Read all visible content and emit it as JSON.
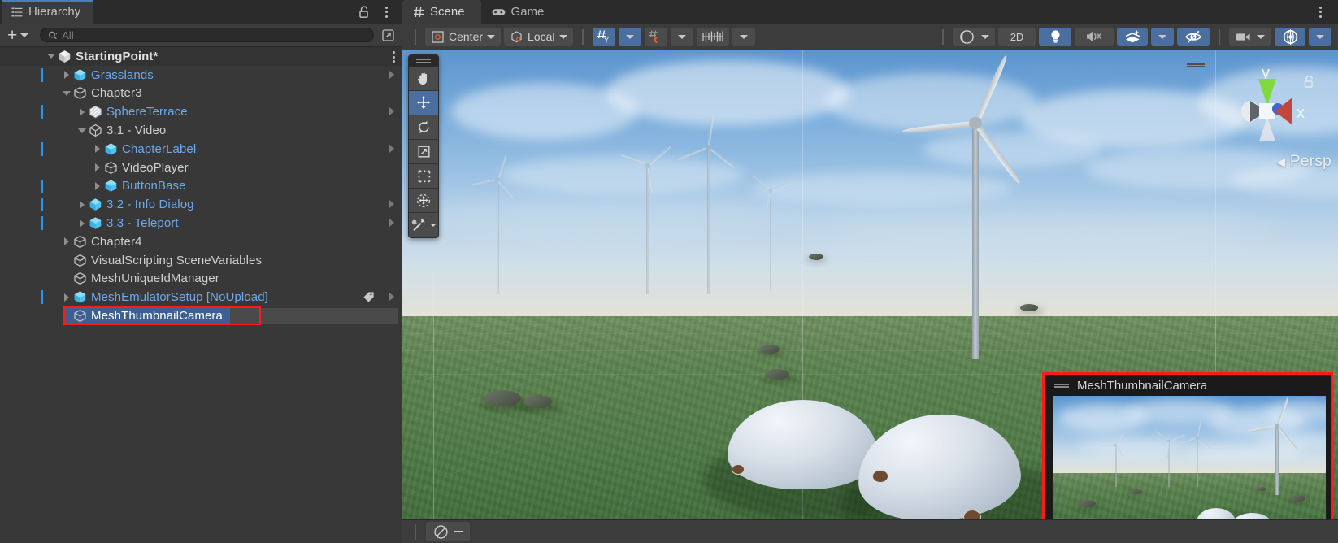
{
  "hierarchy": {
    "tab_label": "Hierarchy",
    "tab_icon": "hierarchy-icon",
    "lock_icon": "lock-open-icon",
    "menu_icon": "kebab-menu-icon",
    "create_label": "+",
    "search": {
      "placeholder": "All",
      "value": "",
      "icon": "search-icon"
    },
    "scene_visibility_icon": "scene-picking-icon",
    "items": [
      {
        "label": "StartingPoint*",
        "depth": 0,
        "icon": "unity-scene-icon",
        "style": "bold",
        "foldout": "down",
        "prefab_bar": false,
        "row_menu": true,
        "chevron": false
      },
      {
        "label": "Grasslands",
        "depth": 1,
        "icon": "prefab-icon",
        "style": "prefab",
        "foldout": "right",
        "prefab_bar": true,
        "chevron": true
      },
      {
        "label": "Chapter3",
        "depth": 1,
        "icon": "gameobject-icon",
        "style": "plain",
        "foldout": "down",
        "prefab_bar": false,
        "chevron": false
      },
      {
        "label": "SphereTerrace",
        "depth": 2,
        "icon": "prefab-variant-icon",
        "style": "prefab",
        "foldout": "right",
        "prefab_bar": true,
        "chevron": true
      },
      {
        "label": "3.1 - Video",
        "depth": 2,
        "icon": "gameobject-icon",
        "style": "plain",
        "foldout": "down",
        "prefab_bar": false,
        "chevron": false
      },
      {
        "label": "ChapterLabel",
        "depth": 3,
        "icon": "prefab-icon",
        "style": "prefab",
        "foldout": "right",
        "prefab_bar": true,
        "chevron": true
      },
      {
        "label": "VideoPlayer",
        "depth": 3,
        "icon": "gameobject-icon",
        "style": "plain",
        "foldout": "right",
        "prefab_bar": false,
        "chevron": false
      },
      {
        "label": "ButtonBase",
        "depth": 3,
        "icon": "prefab-icon",
        "style": "prefab",
        "foldout": "right",
        "prefab_bar": true,
        "chevron": false
      },
      {
        "label": "3.2 - Info Dialog",
        "depth": 2,
        "icon": "prefab-icon",
        "style": "prefab",
        "foldout": "right",
        "prefab_bar": true,
        "chevron": true
      },
      {
        "label": "3.3 - Teleport",
        "depth": 2,
        "icon": "prefab-icon",
        "style": "prefab",
        "foldout": "right",
        "prefab_bar": true,
        "chevron": true
      },
      {
        "label": "Chapter4",
        "depth": 1,
        "icon": "gameobject-icon",
        "style": "plain",
        "foldout": "right",
        "prefab_bar": false,
        "chevron": false
      },
      {
        "label": "VisualScripting SceneVariables",
        "depth": 1,
        "icon": "gameobject-icon",
        "style": "plain",
        "foldout": "none",
        "prefab_bar": false,
        "chevron": false
      },
      {
        "label": "MeshUniqueIdManager",
        "depth": 1,
        "icon": "gameobject-icon",
        "style": "plain",
        "foldout": "none",
        "prefab_bar": false,
        "chevron": false
      },
      {
        "label": "MeshEmulatorSetup [NoUpload]",
        "depth": 1,
        "icon": "prefab-icon",
        "style": "prefab",
        "foldout": "right",
        "prefab_bar": true,
        "chevron": true,
        "tag": true
      },
      {
        "label": "MeshThumbnailCamera",
        "depth": 1,
        "icon": "gameobject-icon",
        "style": "selected",
        "foldout": "none",
        "prefab_bar": false,
        "chevron": false,
        "selected": true,
        "highlight": true
      }
    ]
  },
  "scene": {
    "tabs": [
      {
        "label": "Scene",
        "icon": "grid-icon",
        "active": true
      },
      {
        "label": "Game",
        "icon": "gamepad-icon",
        "active": false
      }
    ],
    "menu_icon": "kebab-menu-icon",
    "toolbar": {
      "pivot_mode": {
        "label": "Center",
        "icon": "pivot-center-icon",
        "dropdown": true
      },
      "handle_space": {
        "label": "Local",
        "icon": "handle-local-icon",
        "dropdown": true
      },
      "grid_axis": {
        "icon": "grid-axis-y-icon",
        "active": true,
        "dropdown": true
      },
      "snap_magnet": {
        "icon": "snap-magnet-icon",
        "active": false,
        "dropdown": true
      },
      "snap_increment": {
        "icon": "snap-increment-icon",
        "active": false,
        "dropdown": false
      },
      "shading_mode": {
        "icon": "shaded-sphere-icon",
        "dropdown": true
      },
      "view_2d": {
        "label": "2D",
        "active": false
      },
      "lighting": {
        "icon": "lightbulb-icon",
        "active": true
      },
      "audio": {
        "icon": "audio-muted-icon",
        "active": false
      },
      "effects": {
        "icon": "fx-sparkle-icon",
        "active": true,
        "dropdown": true
      },
      "visibility": {
        "icon": "eye-hidden-icon",
        "active": true
      },
      "camera_overlay": {
        "icon": "camera-icon",
        "active": false,
        "dropdown": true
      },
      "gizmos": {
        "icon": "gizmo-globe-icon",
        "active": true,
        "dropdown": true
      }
    },
    "tools": [
      {
        "name": "hand-tool",
        "icon": "hand-icon",
        "active": false
      },
      {
        "name": "move-tool",
        "icon": "move-arrows-icon",
        "active": true
      },
      {
        "name": "rotate-tool",
        "icon": "rotate-icon",
        "active": false
      },
      {
        "name": "scale-tool",
        "icon": "scale-icon",
        "active": false
      },
      {
        "name": "rect-tool",
        "icon": "rect-transform-icon",
        "active": false
      },
      {
        "name": "transform-tool",
        "icon": "transform-combined-icon",
        "active": false
      },
      {
        "name": "custom-tool",
        "icon": "wrench-screwdriver-icon",
        "active": false
      }
    ],
    "gizmo": {
      "axis_y_label": "y",
      "axis_x_label": "x",
      "projection_label": "Persp",
      "projection_arrow": "◀",
      "lock_icon": "lock-open-icon"
    },
    "camera_preview": {
      "title": "MeshThumbnailCamera",
      "grip_icon": "drag-grip-icon"
    },
    "status": {
      "snap_icon": "scene-compass-icon"
    }
  },
  "colors": {
    "accent_blue": "#4a7ebb",
    "prefab_blue": "#6ca9f0",
    "selection_blue": "#3d6090",
    "highlight_red": "#ff1a1a",
    "panel_bg": "#383838",
    "toolbar_bg": "#3c3c3c",
    "tab_bg": "#2b2b2b",
    "btn_on": "#4a6f9e"
  }
}
